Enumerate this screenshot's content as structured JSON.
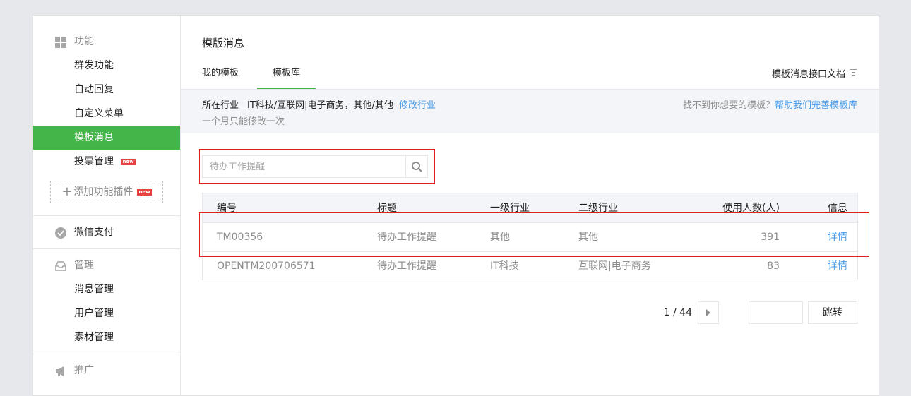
{
  "sidebar": {
    "sections": [
      {
        "title": "功能",
        "icon": "grid-icon",
        "items": [
          {
            "label": "群发功能",
            "active": false
          },
          {
            "label": "自动回复",
            "active": false
          },
          {
            "label": "自定义菜单",
            "active": false
          },
          {
            "label": "模板消息",
            "active": true
          },
          {
            "label": "投票管理",
            "active": false,
            "badge": "new"
          }
        ]
      },
      {
        "title": "微信支付",
        "icon": "wechat-pay-icon"
      },
      {
        "title": "管理",
        "icon": "inbox-icon",
        "items": [
          {
            "label": "消息管理"
          },
          {
            "label": "用户管理"
          },
          {
            "label": "素材管理"
          }
        ]
      },
      {
        "title": "推广",
        "icon": "megaphone-icon"
      }
    ],
    "add_plugin": {
      "label": "添加功能插件",
      "badge": "new"
    }
  },
  "main": {
    "title": "模版消息",
    "tabs": [
      {
        "label": "我的模板",
        "active": false
      },
      {
        "label": "模板库",
        "active": true
      }
    ],
    "doc_link": "模板消息接口文档",
    "industry": {
      "label": "所在行业",
      "value": "IT科技/互联网|电子商务，其他/其他",
      "modify_link": "修改行业",
      "note": "一个月只能修改一次",
      "help_text": "找不到你想要的模板？",
      "help_link": "帮助我们完善模板库"
    },
    "search": {
      "value": "",
      "placeholder": "待办工作提醒"
    },
    "table": {
      "headers": [
        "编号",
        "标题",
        "一级行业",
        "二级行业",
        "使用人数(人)",
        "信息"
      ],
      "rows": [
        [
          "TM00356",
          "待办工作提醒",
          "其他",
          "其他",
          "391",
          "详情"
        ],
        [
          "OPENTM200706571",
          "待办工作提醒",
          "IT科技",
          "互联网|电子商务",
          "83",
          "详情"
        ]
      ]
    },
    "pager": {
      "info": "1 / 44",
      "goto_label": "跳转"
    }
  },
  "colors": {
    "accent": "#44b549",
    "link": "#459ae9",
    "highlight": "#e02020",
    "badge": "#e64340"
  }
}
